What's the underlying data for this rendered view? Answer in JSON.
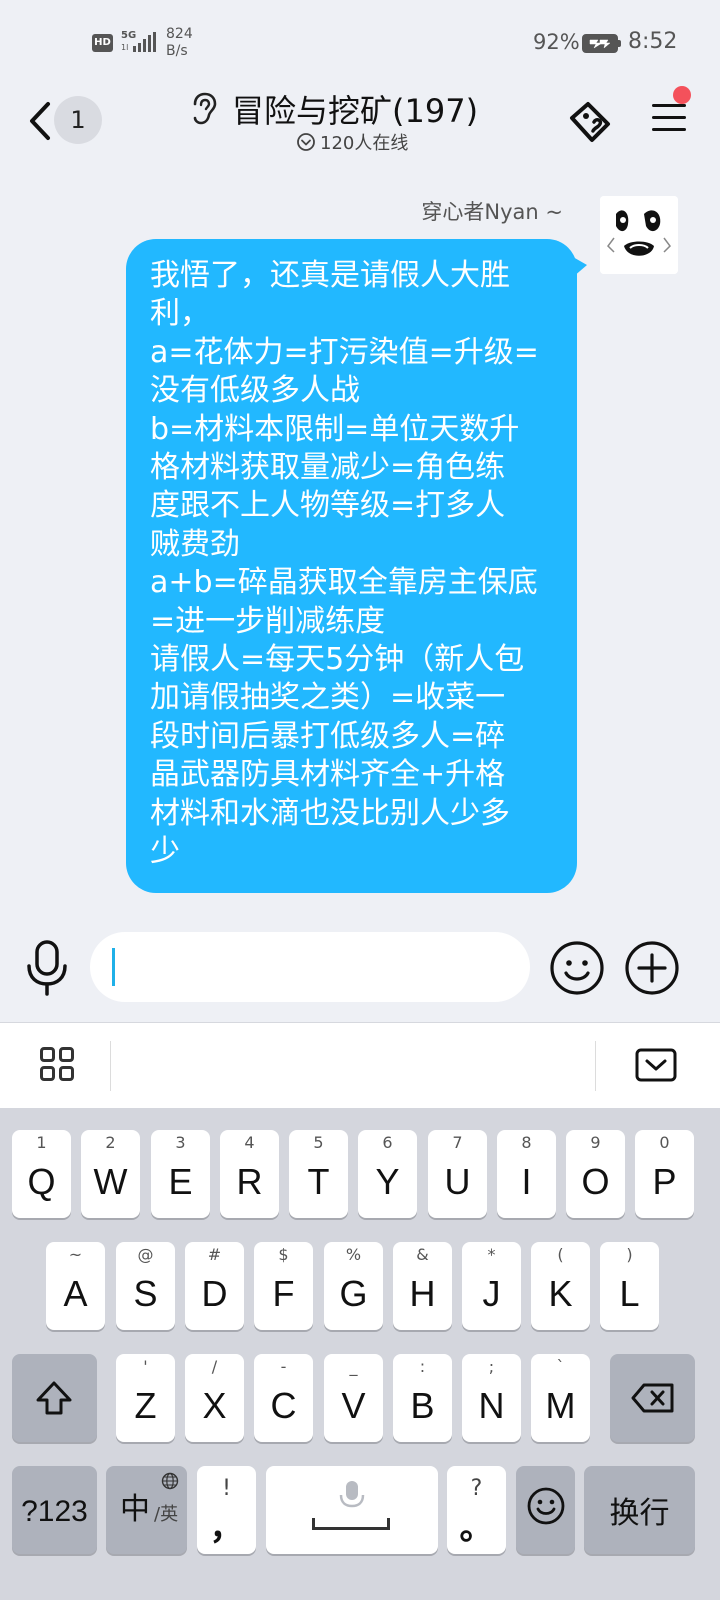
{
  "status_bar": {
    "hd": "HD",
    "network": "5G",
    "network_sub": "1l",
    "speed_value": "824",
    "speed_unit": "B/s",
    "battery": "92%",
    "time": "8:52"
  },
  "header": {
    "unread_count": "1",
    "title": "冒险与挖矿(197)",
    "online": "120人在线"
  },
  "message": {
    "sender": "穿心者Nyan ~",
    "lines": [
      "我悟了，还真是请假人大胜",
      "利，",
      "a=花体力=打污染值=升级=",
      "没有低级多人战",
      "b=材料本限制=单位天数升",
      "格材料获取量减少=角色练",
      "度跟不上人物等级=打多人",
      "贼费劲",
      "a+b=碎晶获取全靠房主保底",
      "=进一步削减练度",
      "请假人=每天5分钟（新人包",
      "加请假抽奖之类）=收菜一",
      "段时间后暴打低级多人=碎",
      "晶武器防具材料齐全+升格",
      "材料和水滴也没比别人少多",
      "少"
    ]
  },
  "input": {
    "value": "",
    "placeholder": ""
  },
  "keyboard": {
    "row1": [
      {
        "letter": "Q",
        "hint": "1"
      },
      {
        "letter": "W",
        "hint": "2"
      },
      {
        "letter": "E",
        "hint": "3"
      },
      {
        "letter": "R",
        "hint": "4"
      },
      {
        "letter": "T",
        "hint": "5"
      },
      {
        "letter": "Y",
        "hint": "6"
      },
      {
        "letter": "U",
        "hint": "7"
      },
      {
        "letter": "I",
        "hint": "8"
      },
      {
        "letter": "O",
        "hint": "9"
      },
      {
        "letter": "P",
        "hint": "0"
      }
    ],
    "row2": [
      {
        "letter": "A",
        "hint": "~"
      },
      {
        "letter": "S",
        "hint": "@"
      },
      {
        "letter": "D",
        "hint": "#"
      },
      {
        "letter": "F",
        "hint": "$"
      },
      {
        "letter": "G",
        "hint": "%"
      },
      {
        "letter": "H",
        "hint": "&"
      },
      {
        "letter": "J",
        "hint": "*"
      },
      {
        "letter": "K",
        "hint": "("
      },
      {
        "letter": "L",
        "hint": ")"
      }
    ],
    "row3": [
      {
        "letter": "Z",
        "hint": "'"
      },
      {
        "letter": "X",
        "hint": "/"
      },
      {
        "letter": "C",
        "hint": "-"
      },
      {
        "letter": "V",
        "hint": "_"
      },
      {
        "letter": "B",
        "hint": ":"
      },
      {
        "letter": "N",
        "hint": ";"
      },
      {
        "letter": "M",
        "hint": "`"
      }
    ],
    "symbols_key": "?123",
    "lang_main": "中",
    "lang_sub": "/英",
    "comma_top": "!",
    "comma_main": "，",
    "period_top": "?",
    "period_main": "。",
    "enter_key": "换行"
  },
  "colors": {
    "bubble": "#22b8ff",
    "background": "#eef0f5",
    "notification_dot": "#f4515b",
    "caret": "#1fb0e8"
  }
}
